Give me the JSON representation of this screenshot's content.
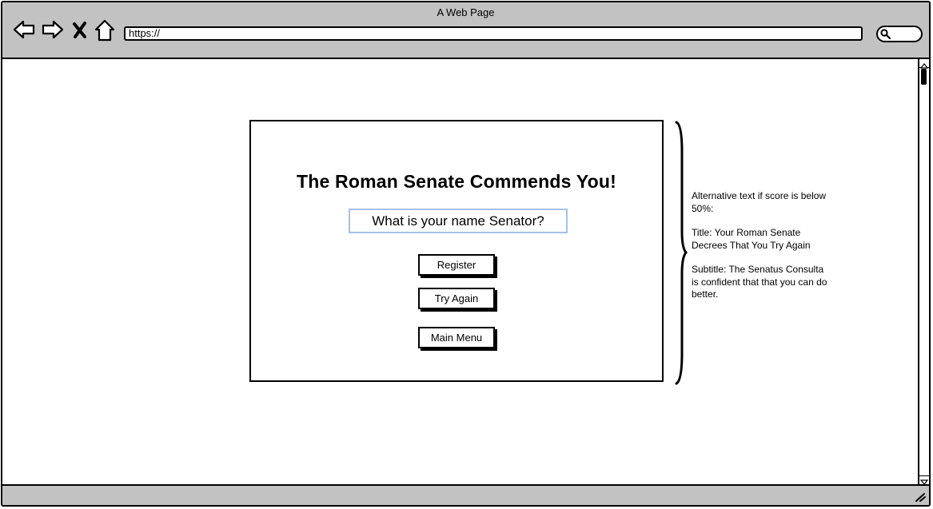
{
  "window": {
    "title": "A Web Page"
  },
  "browser": {
    "url": "https://",
    "icons": [
      "back-icon",
      "forward-icon",
      "close-icon",
      "home-icon",
      "search-icon"
    ]
  },
  "dialog": {
    "title": "The Roman Senate Commends You!",
    "name_placeholder": "What is your name Senator?",
    "buttons": {
      "register": "Register",
      "try_again": "Try Again",
      "main_menu": "Main Menu"
    }
  },
  "annotation": {
    "heading": "Alternative text if score is below 50%:",
    "title_note": "Title: Your Roman Senate Decrees That You Try Again",
    "subtitle_note": "Subtitle: The Senatus Consulta is confident that that you can do better."
  },
  "colors": {
    "chrome": "#c2c2c2",
    "input_border": "#a6c0e8",
    "ink": "#000000"
  }
}
